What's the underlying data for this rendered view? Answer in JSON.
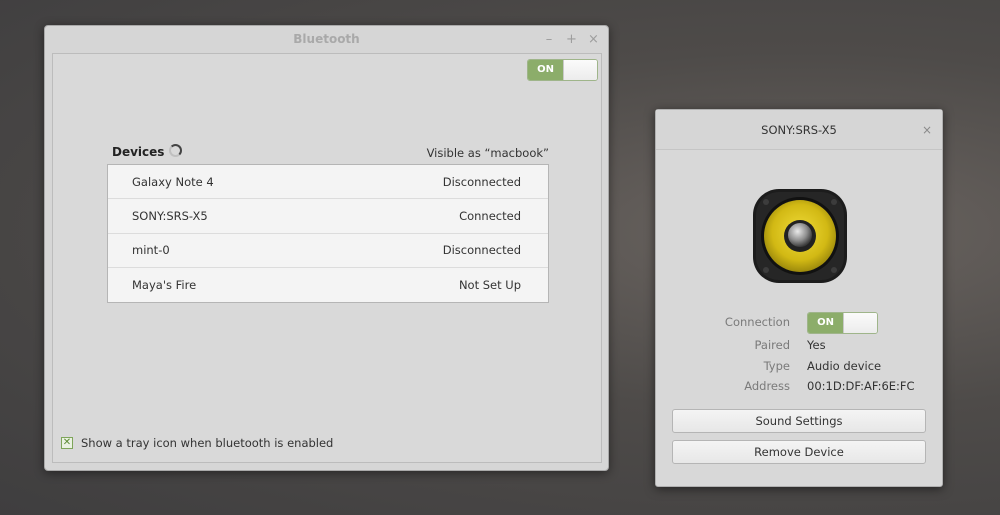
{
  "main_window": {
    "title": "Bluetooth",
    "controls": {
      "minimize": "–",
      "maximize": "+",
      "close": "×"
    },
    "power_toggle": {
      "label": "ON",
      "state": "on"
    },
    "devices_label": "Devices",
    "visible_as": "Visible as “macbook”",
    "devices": [
      {
        "name": "Galaxy Note 4",
        "status": "Disconnected"
      },
      {
        "name": "SONY:SRS-X5",
        "status": "Connected"
      },
      {
        "name": "mint-0",
        "status": "Disconnected"
      },
      {
        "name": "Maya's Fire",
        "status": "Not Set Up"
      }
    ],
    "tray_option": {
      "label": "Show a tray icon when bluetooth is enabled",
      "checked": true
    }
  },
  "device_window": {
    "title": "SONY:SRS-X5",
    "close": "×",
    "icon": "speaker-icon",
    "connection": {
      "label": "Connection",
      "toggle_label": "ON",
      "state": "on"
    },
    "paired": {
      "label": "Paired",
      "value": "Yes"
    },
    "type": {
      "label": "Type",
      "value": "Audio device"
    },
    "address": {
      "label": "Address",
      "value": "00:1D:DF:AF:6E:FC"
    },
    "buttons": {
      "sound_settings": "Sound Settings",
      "remove_device": "Remove Device"
    }
  },
  "colors": {
    "accent_green": "#8cad6a",
    "speaker_yellow": "#d8c21a"
  }
}
